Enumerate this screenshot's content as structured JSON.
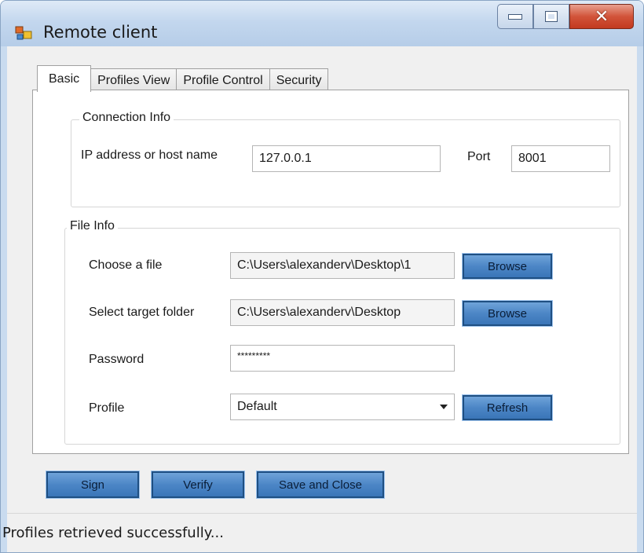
{
  "window": {
    "title": "Remote client",
    "minimize_icon": "minimize-icon",
    "maximize_icon": "maximize-icon",
    "close_icon": "close-icon",
    "close_glyph": "✕"
  },
  "tabs": [
    {
      "label": "Basic",
      "active": true
    },
    {
      "label": "Profiles View",
      "active": false
    },
    {
      "label": "Profile Control",
      "active": false
    },
    {
      "label": "Security",
      "active": false
    }
  ],
  "connection_info": {
    "title": "Connection Info",
    "host_label": "IP address or host name",
    "host_value": "127.0.0.1",
    "port_label": "Port",
    "port_value": "8001"
  },
  "file_info": {
    "title": "File Info",
    "file_label": "Choose a file",
    "file_value": "C:\\Users\\alexanderv\\Desktop\\1",
    "file_browse": "Browse",
    "folder_label": "Select target folder",
    "folder_value": "C:\\Users\\alexanderv\\Desktop",
    "folder_browse": "Browse",
    "password_label": "Password",
    "password_value": "*********",
    "profile_label": "Profile",
    "profile_value": "Default",
    "refresh": "Refresh"
  },
  "actions": {
    "sign": "Sign",
    "verify": "Verify",
    "save_close": "Save and Close"
  },
  "status": {
    "text": "Profiles retrieved successfully..."
  },
  "colors": {
    "button_blue": "#4c86c6",
    "titlebar": "#c3d7ee",
    "close_red": "#d2543a"
  }
}
